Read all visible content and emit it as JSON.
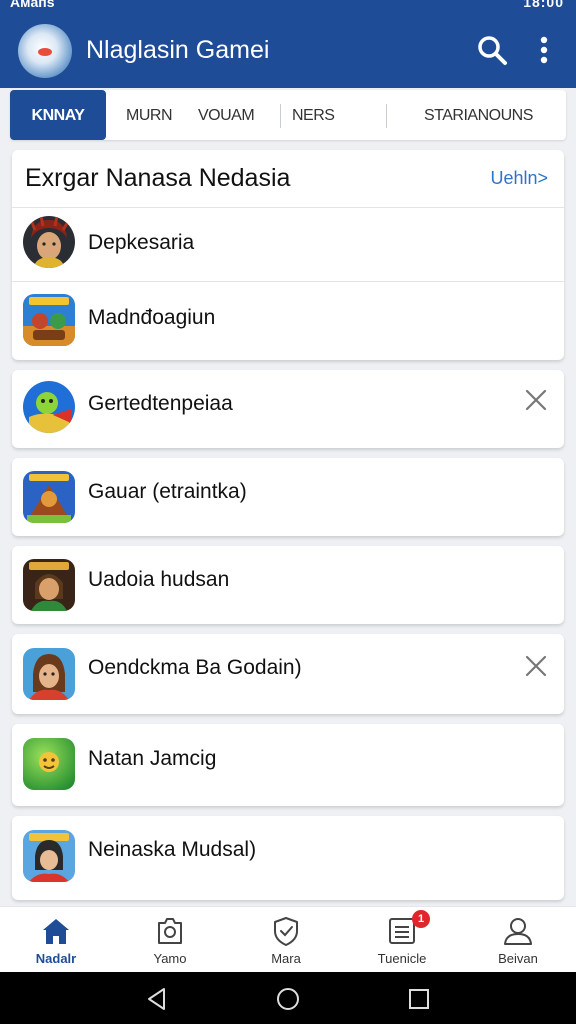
{
  "status_bar": {
    "left_text": "Aмaпs",
    "right_text": "18:00"
  },
  "app_bar": {
    "title": "Nlaglasin Gamei"
  },
  "tabs": [
    {
      "label": "KNNAY",
      "active": true
    },
    {
      "label": "MURN"
    },
    {
      "label": "VOUAM"
    },
    {
      "label": "NERS"
    },
    {
      "label": "STARIANOUNS"
    }
  ],
  "section": {
    "title": "Exrgar Nanasa Nedasia",
    "link": "Uehln>",
    "rows": [
      {
        "label": "Depkesaria"
      },
      {
        "label": "Madnđoagiun"
      }
    ]
  },
  "cards": [
    {
      "label": "Gertedtenpeiaa",
      "dismissible": true
    },
    {
      "label": "Gauar (etraintka)",
      "dismissible": false
    },
    {
      "label": "Uadoia hudsan",
      "dismissible": false
    },
    {
      "label": "Oendckma Ba Godain)",
      "dismissible": true
    },
    {
      "label": "Natan Jamcig",
      "dismissible": false
    },
    {
      "label": "Neinaska Mudsal)",
      "dismissible": false
    }
  ],
  "bottom_nav": [
    {
      "label": "Nadalr",
      "icon": "home-icon",
      "active": true
    },
    {
      "label": "Yamo",
      "icon": "camera-icon"
    },
    {
      "label": "Mara",
      "icon": "shield-check-icon"
    },
    {
      "label": "Tuenicle",
      "icon": "list-icon",
      "badge": "1"
    },
    {
      "label": "Beivan",
      "icon": "profile-icon"
    }
  ],
  "colors": {
    "primary": "#1e4c97",
    "link": "#2f73c9",
    "badge": "#e0262c",
    "background": "#eef0f3"
  }
}
